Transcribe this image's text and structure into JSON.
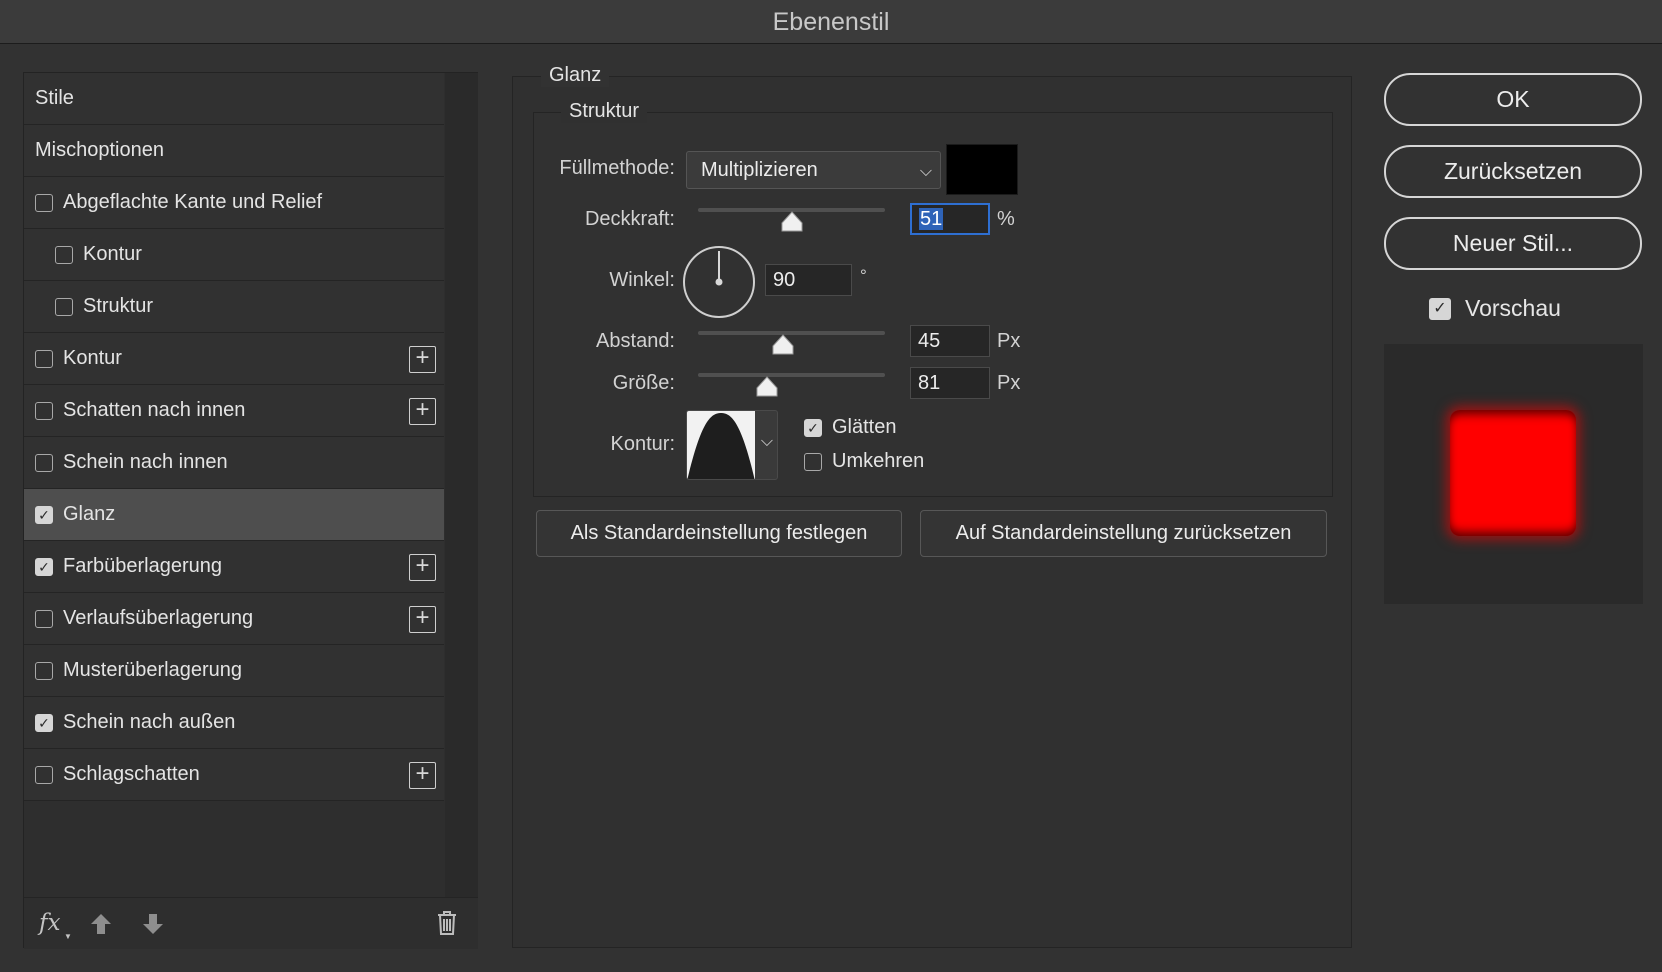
{
  "window": {
    "title": "Ebenenstil"
  },
  "styles_list": {
    "items": [
      {
        "label": "Stile",
        "type": "header"
      },
      {
        "label": "Mischoptionen",
        "type": "header"
      },
      {
        "label": "Abgeflachte Kante und Relief",
        "checked": false,
        "indent": 0,
        "plus": false
      },
      {
        "label": "Kontur",
        "checked": false,
        "indent": 1,
        "plus": false
      },
      {
        "label": "Struktur",
        "checked": false,
        "indent": 1,
        "plus": false
      },
      {
        "label": "Kontur",
        "checked": false,
        "indent": 0,
        "plus": true
      },
      {
        "label": "Schatten nach innen",
        "checked": false,
        "indent": 0,
        "plus": true
      },
      {
        "label": "Schein nach innen",
        "checked": false,
        "indent": 0,
        "plus": false
      },
      {
        "label": "Glanz",
        "checked": true,
        "indent": 0,
        "plus": false,
        "selected": true
      },
      {
        "label": "Farbüberlagerung",
        "checked": true,
        "indent": 0,
        "plus": true
      },
      {
        "label": "Verlaufsüberlagerung",
        "checked": false,
        "indent": 0,
        "plus": true
      },
      {
        "label": "Musterüberlagerung",
        "checked": false,
        "indent": 0,
        "plus": false
      },
      {
        "label": "Schein nach außen",
        "checked": true,
        "indent": 0,
        "plus": false
      },
      {
        "label": "Schlagschatten",
        "checked": false,
        "indent": 0,
        "plus": true
      }
    ],
    "footer": {
      "fx_label": "fx",
      "icons": [
        "fx-menu-icon",
        "arrow-up-icon",
        "arrow-down-icon",
        "trash-icon"
      ]
    }
  },
  "glanz": {
    "section_title": "Glanz",
    "group_title": "Struktur",
    "fill_method": {
      "label": "Füllmethode:",
      "value": "Multiplizieren",
      "color": "#000000"
    },
    "opacity": {
      "label": "Deckkraft:",
      "value": "51",
      "unit": "%",
      "slider_fraction": 0.51
    },
    "angle": {
      "label": "Winkel:",
      "value": "90",
      "unit": "°"
    },
    "distance": {
      "label": "Abstand:",
      "value": "45",
      "unit": "Px",
      "slider_fraction": 0.45
    },
    "size": {
      "label": "Größe:",
      "value": "81",
      "unit": "Px",
      "slider_fraction": 0.37
    },
    "contour": {
      "label": "Kontur:"
    },
    "antialias": {
      "label": "Glätten",
      "checked": true
    },
    "invert": {
      "label": "Umkehren",
      "checked": false
    },
    "buttons": {
      "make_default": "Als Standardeinstellung festlegen",
      "reset_default": "Auf Standardeinstellung zurücksetzen"
    }
  },
  "actions": {
    "ok": "OK",
    "reset": "Zurücksetzen",
    "new_style": "Neuer Stil...",
    "preview": {
      "label": "Vorschau",
      "checked": true
    }
  },
  "colors": {
    "preview_fill": "#ff0000",
    "focus": "#2e6fd2"
  }
}
